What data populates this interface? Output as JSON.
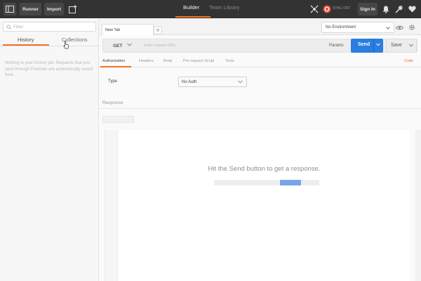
{
  "topbar": {
    "runner_label": "Runner",
    "import_label": "Import",
    "tabs": [
      {
        "label": "Builder",
        "active": true
      },
      {
        "label": "Team Library",
        "active": false
      }
    ],
    "sync_status": "SYNC OFF",
    "signin_label": "Sign In",
    "accent_color": "#f47023"
  },
  "sidebar": {
    "filter_placeholder": "Filter",
    "tabs": [
      {
        "label": "History",
        "active": true
      },
      {
        "label": "Collections",
        "active": false
      }
    ],
    "empty_message": "Nothing in your history yet. Requests that you send through Postman are automatically saved here."
  },
  "main": {
    "request_tab_label": "New Tab",
    "add_tab_label": "+",
    "environment": "No Environment",
    "method": "GET",
    "url_placeholder": "Enter request URL",
    "params_label": "Params",
    "send_label": "Send",
    "send_color": "#2a7de1",
    "save_label": "Save",
    "request_tabs": [
      {
        "label": "Authorization",
        "active": true
      },
      {
        "label": "Headers",
        "active": false
      },
      {
        "label": "Body",
        "active": false
      },
      {
        "label": "Pre-request Script",
        "active": false
      },
      {
        "label": "Tests",
        "active": false
      }
    ],
    "code_label": "Code",
    "auth": {
      "type_label": "Type",
      "selected": "No Auth"
    },
    "response_label": "Response",
    "response_hint": "Hit the Send button to get a response."
  }
}
